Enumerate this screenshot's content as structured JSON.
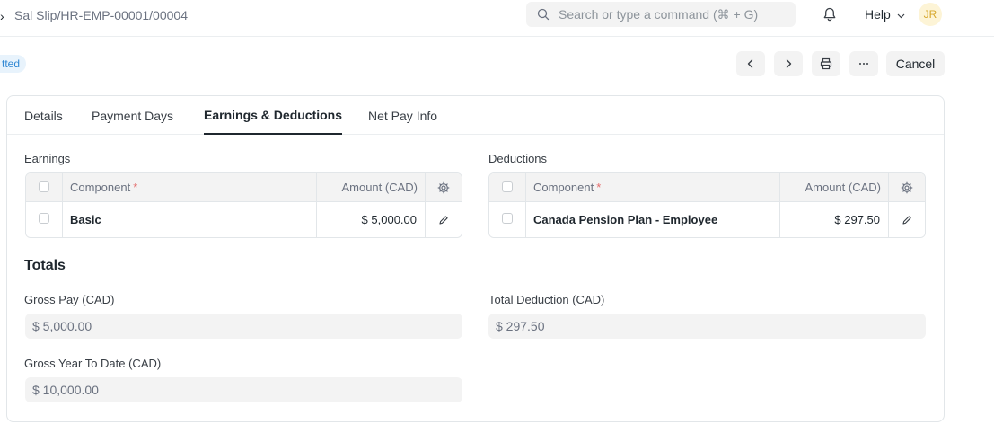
{
  "navbar": {
    "breadcrumb": "Sal Slip/HR-EMP-00001/00004",
    "search_placeholder": "Search or type a command (⌘ + G)",
    "help_label": "Help",
    "avatar_initials": "JR"
  },
  "page_head": {
    "status": "tted",
    "cancel_label": "Cancel"
  },
  "tabs": [
    {
      "label": "Details",
      "active": false
    },
    {
      "label": "Payment Days",
      "active": false
    },
    {
      "label": "Earnings & Deductions",
      "active": true
    },
    {
      "label": "Net Pay Info",
      "active": false
    }
  ],
  "earnings": {
    "label": "Earnings",
    "columns": {
      "component": "Component",
      "required_mark": "*",
      "amount": "Amount (CAD)"
    },
    "rows": [
      {
        "component": "Basic",
        "amount": "$ 5,000.00"
      }
    ]
  },
  "deductions": {
    "label": "Deductions",
    "columns": {
      "component": "Component",
      "required_mark": "*",
      "amount": "Amount (CAD)"
    },
    "rows": [
      {
        "component": "Canada Pension Plan - Employee",
        "amount": "$ 297.50"
      }
    ]
  },
  "totals": {
    "title": "Totals",
    "gross_pay": {
      "label": "Gross Pay (CAD)",
      "value": "$ 5,000.00"
    },
    "total_deduction": {
      "label": "Total Deduction (CAD)",
      "value": "$ 297.50"
    },
    "gross_ytd": {
      "label": "Gross Year To Date (CAD)",
      "value": "$ 10,000.00"
    }
  },
  "colors": {
    "status_bg": "#e8f3fc",
    "status_text": "#2f87d3",
    "required": "#e36b6b",
    "avatar_bg": "#fdf4d6",
    "avatar_text": "#d6a72b"
  },
  "icons": [
    "chevron-right-icon",
    "search-icon",
    "bell-icon",
    "chevron-down-icon",
    "chevron-left-icon",
    "printer-icon",
    "more-icon",
    "gear-icon",
    "pencil-icon"
  ]
}
